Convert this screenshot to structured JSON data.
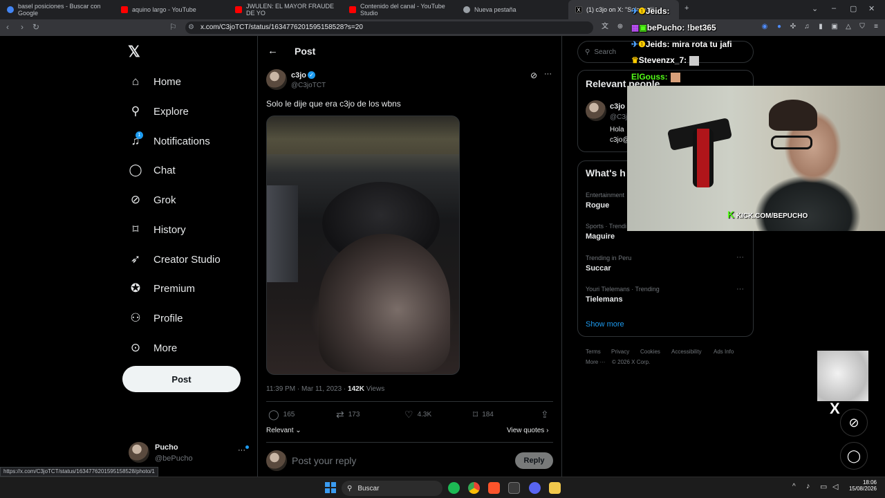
{
  "browser": {
    "tabs": [
      {
        "label": "basel posiciones - Buscar con Google",
        "color": "#4285f4"
      },
      {
        "label": "aquino largo - YouTube",
        "color": "#ff0000"
      },
      {
        "label": "JWULEN: EL MAYOR FRAUDE DE YO",
        "color": "#ff0000"
      },
      {
        "label": "Contenido del canal - YouTube Studio",
        "color": "#ff0000"
      },
      {
        "label": "Nueva pestaña",
        "color": "#9aa0a6"
      },
      {
        "label": "(1) c3jo on X: \"Solo le dij",
        "color": "#ffffff"
      }
    ],
    "url": "x.com/C3joTCT/status/1634776201595158528?s=20",
    "new_tab": "+",
    "status_url": "https://x.com/C3joTCT/status/1634776201595158528/photo/1"
  },
  "x": {
    "logo": "𝕏",
    "nav": [
      {
        "label": "Home",
        "icon": "home-icon",
        "glyph": "⌂"
      },
      {
        "label": "Explore",
        "icon": "search-icon",
        "glyph": "⚲"
      },
      {
        "label": "Notifications",
        "icon": "bell-icon",
        "glyph": "🔔︎",
        "badge": "1"
      },
      {
        "label": "Chat",
        "icon": "chat-icon",
        "glyph": "◯"
      },
      {
        "label": "Grok",
        "icon": "grok-icon",
        "glyph": "⊘"
      },
      {
        "label": "History",
        "icon": "bookmark-icon",
        "glyph": "⌑"
      },
      {
        "label": "Creator Studio",
        "icon": "rocket-icon",
        "glyph": "➶"
      },
      {
        "label": "Premium",
        "icon": "verified-icon",
        "glyph": "✪"
      },
      {
        "label": "Profile",
        "icon": "person-icon",
        "glyph": "⚇"
      },
      {
        "label": "More",
        "icon": "more-circle-icon",
        "glyph": "⊙"
      }
    ],
    "post_button": "Post",
    "account": {
      "name": "Pucho",
      "handle": "@bePucho",
      "more": "···"
    }
  },
  "post": {
    "header": "Post",
    "author_name": "c3jo",
    "author_handle": "@C3joTCT",
    "text": "Solo le dije que era c3jo de los wbns",
    "time": "11:39 PM · Mar 11, 2023 · ",
    "views_count": "142K",
    "views_label": " Views",
    "replies": "165",
    "reposts": "173",
    "likes": "4.3K",
    "bookmarks": "184",
    "sort_label": "Relevant",
    "view_quotes": "View quotes",
    "reply_placeholder": "Post your reply",
    "reply_button": "Reply"
  },
  "sidebar": {
    "search_placeholder": "Search",
    "relevant_title": "Relevant people",
    "person_name": "c3jo",
    "person_handle": "@C3j",
    "person_bio": "Hola",
    "person_bio2": "c3jo@",
    "whats_title": "What's h",
    "trends": [
      {
        "category": "Entertainment",
        "name": "Rogue"
      },
      {
        "category": "Sports · Trendi",
        "name": "Maguire"
      },
      {
        "category": "Trending in Peru",
        "name": "Succar"
      },
      {
        "category": "Youri Tielemans · Trending",
        "name": "Tielemans"
      }
    ],
    "show_more": "Show more",
    "footer": [
      "Terms",
      "Privacy",
      "Cookies",
      "Accessibility",
      "Ads Info",
      "More ···",
      "© 2026 X Corp."
    ]
  },
  "stream": {
    "chat": [
      {
        "user": "Jeids:",
        "msg": "",
        "color": "#ffffff"
      },
      {
        "user": "bePucho:",
        "msg": " !bet365",
        "color": "#ffffff"
      },
      {
        "user": "Jeids:",
        "msg": " mira rota tu jafi",
        "color": "#ffffff"
      },
      {
        "user": "Stevenzx_7:",
        "msg": "",
        "color": "#ffffff"
      },
      {
        "user": "ElGouss:",
        "msg": "",
        "color": "#53fc18"
      }
    ],
    "kick_label": "KICK.COM/BEPUCHO"
  },
  "taskbar": {
    "search": "Buscar",
    "time": "18:06",
    "date": "15/08/2026"
  }
}
